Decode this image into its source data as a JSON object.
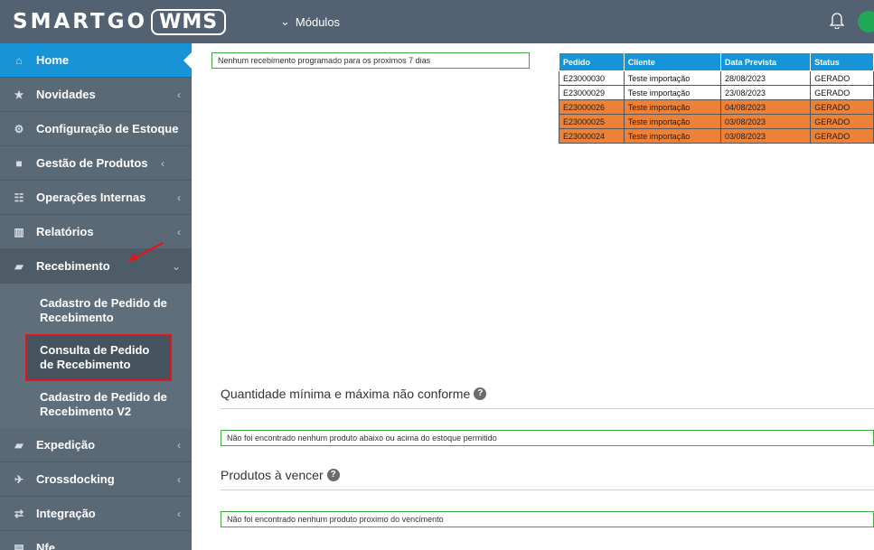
{
  "header": {
    "logo_left": "SMARTGO",
    "logo_right": "WMS",
    "modules_label": "Módulos"
  },
  "sidebar": {
    "items": [
      {
        "label": "Home",
        "icon": "home-icon"
      },
      {
        "label": "Novidades",
        "icon": "star-icon"
      },
      {
        "label": "Configuração de Estoque",
        "icon": "gears-icon"
      },
      {
        "label": "Gestão de Produtos",
        "icon": "box-icon"
      },
      {
        "label": "Operações Internas",
        "icon": "sitemap-icon"
      },
      {
        "label": "Relatórios",
        "icon": "bar-chart-icon"
      },
      {
        "label": "Recebimento",
        "icon": "truck-icon"
      }
    ],
    "submenu": [
      {
        "label": "Cadastro de Pedido de Recebimento"
      },
      {
        "label": "Consulta de Pedido de Recebimento"
      },
      {
        "label": "Cadastro de Pedido de Recebimento V2"
      }
    ],
    "lower_items": [
      {
        "label": "Expedição",
        "icon": "truck-icon"
      },
      {
        "label": "Crossdocking",
        "icon": "plane-icon"
      },
      {
        "label": "Integração",
        "icon": "exchange-icon"
      },
      {
        "label": "Nfe",
        "icon": "file-icon"
      }
    ]
  },
  "main": {
    "no_receipts_msg": "Nenhum recebimento programado para os proximos 7 dias",
    "table": {
      "headers": [
        "Pedido",
        "Cliente",
        "Data Prevista",
        "Status"
      ],
      "rows": [
        {
          "pedido": "E23000030",
          "cliente": "Teste importação",
          "data": "28/08/2023",
          "status": "GERADO",
          "late": false
        },
        {
          "pedido": "E23000029",
          "cliente": "Teste importação",
          "data": "23/08/2023",
          "status": "GERADO",
          "late": false
        },
        {
          "pedido": "E23000026",
          "cliente": "Teste importação",
          "data": "04/08/2023",
          "status": "GERADO",
          "late": true
        },
        {
          "pedido": "E23000025",
          "cliente": "Teste importação",
          "data": "03/08/2023",
          "status": "GERADO",
          "late": true
        },
        {
          "pedido": "E23000024",
          "cliente": "Teste importação",
          "data": "03/08/2023",
          "status": "GERADO",
          "late": true
        }
      ]
    },
    "qty_title": "Quantidade mínima e máxima não conforme",
    "qty_msg": "Não foi encontrado nenhum produto abaixo ou acima do estoque permitido",
    "expiry_title": "Produtos à vencer",
    "expiry_msg": "Não foi encontrado nenhum produto proximo do vencimento"
  },
  "colors": {
    "topbar": "#526272",
    "sidebar": "#5a6976",
    "active": "#1794d8",
    "late_row": "#ed8137",
    "highlight_border": "#e0161b"
  }
}
